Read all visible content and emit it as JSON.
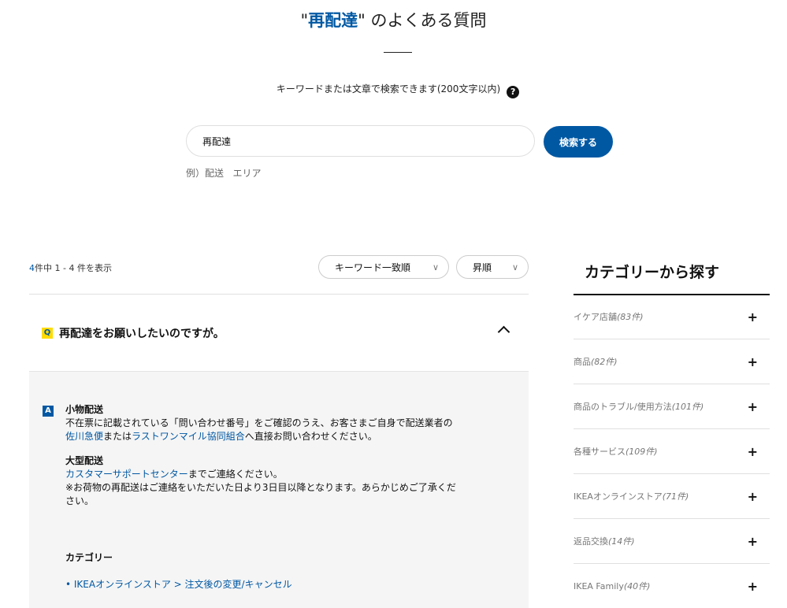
{
  "header": {
    "title_open_quote": "\"",
    "title_keyword": "再配達",
    "title_rest": "\" のよくある質問"
  },
  "search": {
    "hint": "キーワードまたは文章で検索できます(200文字以内)",
    "help_icon": "?",
    "value": "再配達",
    "button_label": "検索する",
    "example_prefix": "例）",
    "examples": [
      "配送",
      "エリア"
    ]
  },
  "results": {
    "total": "4",
    "count_suffix": "件中 1 - 4 件を表示",
    "sort_by": "キーワード一致順",
    "sort_order": "昇順"
  },
  "faq": {
    "q_badge": "Q",
    "question": "再配達をお願いしたいのですが。",
    "a_badge": "A",
    "answer": {
      "small_heading": "小物配送",
      "small_line1": "不在票に記載されている「問い合わせ番号」をご確認のうえ、お客さまご自身で配送業者の",
      "small_link1": "佐川急便",
      "small_mid": "または",
      "small_link2": "ラストワンマイル協同組合",
      "small_end": "へ直接お問い合わせください。",
      "large_heading": "大型配送",
      "large_link": "カスタマーサポートセンター",
      "large_end": "までご連絡ください。",
      "note_line1": "※お荷物の再配送はご連絡をいただいた日より3日目以降となります。あらかじめご了承くだ",
      "note_line2": "さい。"
    },
    "category_heading": "カテゴリー",
    "category_link": "• IKEAオンラインストア > 注文後の変更/キャンセル"
  },
  "sidebar": {
    "heading": "カテゴリーから探す",
    "items": [
      {
        "label": "イケア店舗",
        "count": "(83件)"
      },
      {
        "label": "商品",
        "count": "(82件)"
      },
      {
        "label": "商品のトラブル/使用方法",
        "count": "(101件)"
      },
      {
        "label": "各種サービス",
        "count": "(109件)"
      },
      {
        "label": "IKEAオンラインストア",
        "count": "(71件)"
      },
      {
        "label": "返品交換",
        "count": "(14件)"
      },
      {
        "label": "IKEA Family",
        "count": "(40件)"
      }
    ],
    "plus_icon": "+"
  },
  "colors": {
    "brand_blue": "#0058a3",
    "brand_yellow": "#ffdb00"
  }
}
